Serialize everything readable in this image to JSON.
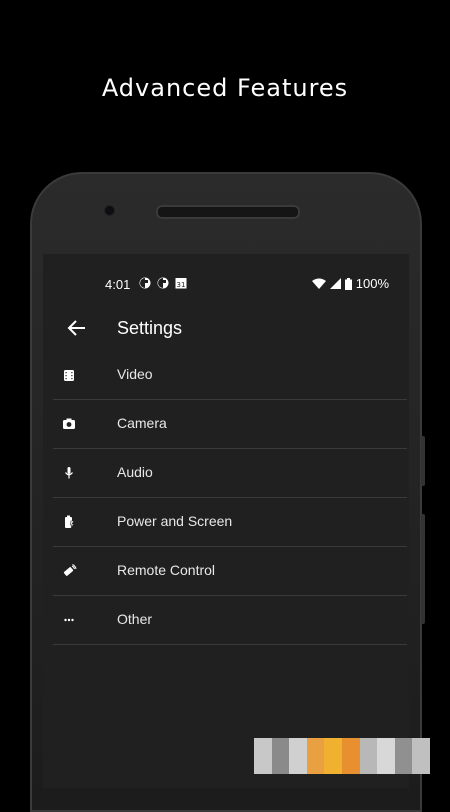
{
  "headline": "Advanced Features",
  "status": {
    "time": "4:01",
    "calendar_day": "31",
    "battery": "100%"
  },
  "toolbar": {
    "title": "Settings"
  },
  "items": [
    {
      "label": "Video",
      "icon": "video-icon"
    },
    {
      "label": "Camera",
      "icon": "camera-icon"
    },
    {
      "label": "Audio",
      "icon": "mic-icon"
    },
    {
      "label": "Power and Screen",
      "icon": "battery-icon"
    },
    {
      "label": "Remote Control",
      "icon": "remote-icon"
    },
    {
      "label": "Other",
      "icon": "more-icon"
    }
  ]
}
